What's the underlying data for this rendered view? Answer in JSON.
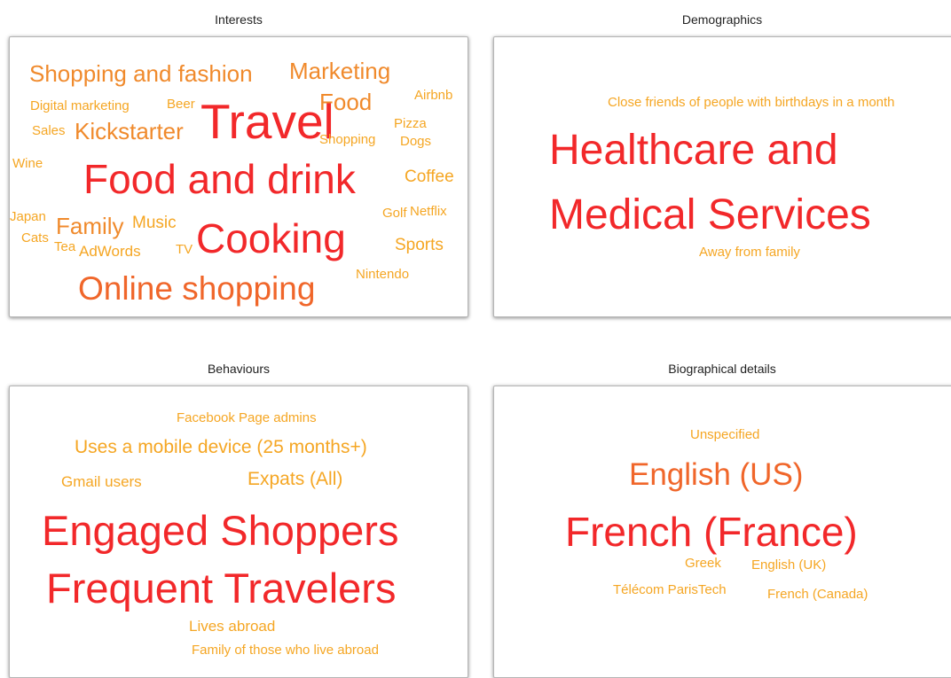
{
  "colors": {
    "c1": "#f5a623",
    "c2": "#f07f2a",
    "c3": "#f04a26",
    "c4": "#f2282a",
    "title": "#222222"
  },
  "panels": [
    {
      "title": "Interests",
      "words": [
        {
          "text": "Shopping and fashion",
          "weight": 3,
          "color": "#f08a2c"
        },
        {
          "text": "Marketing",
          "weight": 3,
          "color": "#f08a2c"
        },
        {
          "text": "Digital marketing",
          "weight": 1,
          "color": "#f5a623"
        },
        {
          "text": "Beer",
          "weight": 1,
          "color": "#f5a623"
        },
        {
          "text": "Food",
          "weight": 3,
          "color": "#f08a2c"
        },
        {
          "text": "Airbnb",
          "weight": 1,
          "color": "#f5a623"
        },
        {
          "text": "Pizza",
          "weight": 1,
          "color": "#f5a623"
        },
        {
          "text": "Sales",
          "weight": 1,
          "color": "#f5a623"
        },
        {
          "text": "Kickstarter",
          "weight": 3,
          "color": "#f08a2c"
        },
        {
          "text": "Travel",
          "weight": 5,
          "color": "#f2282a"
        },
        {
          "text": "Shopping",
          "weight": 1,
          "color": "#f5a623"
        },
        {
          "text": "Dogs",
          "weight": 1,
          "color": "#f5a623"
        },
        {
          "text": "Wine",
          "weight": 1,
          "color": "#f5a623"
        },
        {
          "text": "Food and drink",
          "weight": 5,
          "color": "#f2282a"
        },
        {
          "text": "Coffee",
          "weight": 2,
          "color": "#f5a623"
        },
        {
          "text": "Japan",
          "weight": 1,
          "color": "#f5a623"
        },
        {
          "text": "Family",
          "weight": 3,
          "color": "#f08a2c"
        },
        {
          "text": "Music",
          "weight": 2,
          "color": "#f5a623"
        },
        {
          "text": "Golf",
          "weight": 1,
          "color": "#f5a623"
        },
        {
          "text": "Netflix",
          "weight": 1,
          "color": "#f5a623"
        },
        {
          "text": "Cats",
          "weight": 1,
          "color": "#f5a623"
        },
        {
          "text": "Tea",
          "weight": 1,
          "color": "#f5a623"
        },
        {
          "text": "AdWords",
          "weight": 1,
          "color": "#f5a623"
        },
        {
          "text": "TV",
          "weight": 1,
          "color": "#f5a623"
        },
        {
          "text": "Cooking",
          "weight": 5,
          "color": "#f2282a"
        },
        {
          "text": "Sports",
          "weight": 1,
          "color": "#f5a623"
        },
        {
          "text": "Nintendo",
          "weight": 1,
          "color": "#f5a623"
        },
        {
          "text": "Online shopping",
          "weight": 4,
          "color": "#f0662a"
        }
      ]
    },
    {
      "title": "Demographics",
      "words": [
        {
          "text": "Close friends of people with birthdays in a month",
          "weight": 1,
          "color": "#f5a623"
        },
        {
          "text": "Healthcare and",
          "weight": 5,
          "color": "#f2282a"
        },
        {
          "text": "Medical Services",
          "weight": 5,
          "color": "#f2282a"
        },
        {
          "text": "Away from family",
          "weight": 1,
          "color": "#f5a623"
        }
      ]
    },
    {
      "title": "Behaviours",
      "words": [
        {
          "text": "Facebook Page admins",
          "weight": 1,
          "color": "#f5a623"
        },
        {
          "text": "Uses a mobile device (25 months+)",
          "weight": 2,
          "color": "#f5a623"
        },
        {
          "text": "Gmail users",
          "weight": 1,
          "color": "#f5a623"
        },
        {
          "text": "Expats (All)",
          "weight": 2,
          "color": "#f5a623"
        },
        {
          "text": "Engaged Shoppers",
          "weight": 5,
          "color": "#f2282a"
        },
        {
          "text": "Frequent Travelers",
          "weight": 5,
          "color": "#f2282a"
        },
        {
          "text": "Lives abroad",
          "weight": 1,
          "color": "#f5a623"
        },
        {
          "text": "Family of those who live abroad",
          "weight": 1,
          "color": "#f5a623"
        }
      ]
    },
    {
      "title": "Biographical details",
      "words": [
        {
          "text": "Unspecified",
          "weight": 1,
          "color": "#f5a623"
        },
        {
          "text": "English (US)",
          "weight": 4,
          "color": "#f0662a"
        },
        {
          "text": "French (France)",
          "weight": 5,
          "color": "#f2282a"
        },
        {
          "text": "Greek",
          "weight": 1,
          "color": "#f5a623"
        },
        {
          "text": "English (UK)",
          "weight": 1,
          "color": "#f5a623"
        },
        {
          "text": "Télécom ParisTech",
          "weight": 1,
          "color": "#f5a623"
        },
        {
          "text": "French (Canada)",
          "weight": 1,
          "color": "#f5a623"
        }
      ]
    }
  ]
}
